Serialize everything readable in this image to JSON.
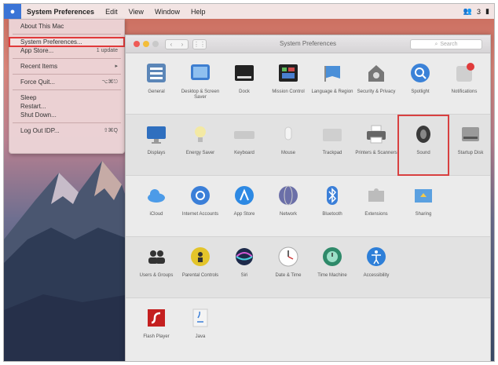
{
  "menubar": {
    "app_name": "System Preferences",
    "menus": [
      "Edit",
      "View",
      "Window",
      "Help"
    ],
    "status_text": "3"
  },
  "apple_menu": {
    "items": [
      {
        "label": "About This Mac",
        "shortcut": ""
      },
      {
        "label": "System Preferences...",
        "shortcut": ""
      },
      {
        "label": "App Store...",
        "shortcut": "1 update"
      },
      {
        "label": "Recent Items",
        "shortcut": "▸"
      },
      {
        "label": "Force Quit...",
        "shortcut": "⌥⌘⎋"
      },
      {
        "label": "Sleep",
        "shortcut": ""
      },
      {
        "label": "Restart...",
        "shortcut": ""
      },
      {
        "label": "Shut Down...",
        "shortcut": ""
      },
      {
        "label": "Log Out IDP...",
        "shortcut": "⇧⌘Q"
      }
    ]
  },
  "window": {
    "title": "System Preferences",
    "search_placeholder": "Search",
    "rows": [
      [
        "General",
        "Desktop & Screen Saver",
        "Dock",
        "Mission Control",
        "Language & Region",
        "Security & Privacy",
        "Spotlight",
        "Notifications"
      ],
      [
        "Displays",
        "Energy Saver",
        "Keyboard",
        "Mouse",
        "Trackpad",
        "Printers & Scanners",
        "Sound",
        "Startup Disk"
      ],
      [
        "iCloud",
        "Internet Accounts",
        "App Store",
        "Network",
        "Bluetooth",
        "Extensions",
        "Sharing"
      ],
      [
        "Users & Groups",
        "Parental Controls",
        "Siri",
        "Date & Time",
        "Time Machine",
        "Accessibility"
      ],
      [
        "Flash Player",
        "Java"
      ]
    ]
  },
  "colors": {
    "highlight": "#e0393a",
    "apple_menu_bg": "#ecd4d6",
    "window_bg": "#ebebeb"
  }
}
